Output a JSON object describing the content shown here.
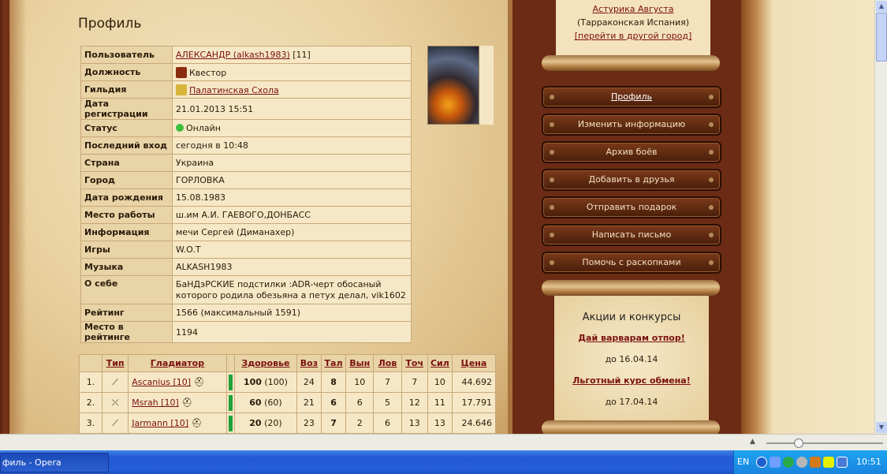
{
  "page": {
    "title": "Профиль"
  },
  "profile": {
    "rows": [
      {
        "key": "Пользователь",
        "value": "АЛЕКСАНДР (alkash1983)",
        "extra": " [11]"
      },
      {
        "key": "Должность",
        "value": "Квестор"
      },
      {
        "key": "Гильдия",
        "value": "Палатинская Схола"
      },
      {
        "key": "Дата регистрации",
        "value": "21.01.2013 15:51"
      },
      {
        "key": "Статус",
        "value": "Онлайн"
      },
      {
        "key": "Последний вход",
        "value": "сегодня в 10:48"
      },
      {
        "key": "Страна",
        "value": "Украина"
      },
      {
        "key": "Город",
        "value": "ГОРЛОВКА"
      },
      {
        "key": "Дата рождения",
        "value": "15.08.1983"
      },
      {
        "key": "Место работы",
        "value": "ш.им А.И. ГАЕВОГО,ДОНБАСС"
      },
      {
        "key": "Информация",
        "value": "мечи Сергей (Диманахер)"
      },
      {
        "key": "Игры",
        "value": "W.O.T"
      },
      {
        "key": "Музыка",
        "value": "ALKASH1983"
      },
      {
        "key": "О себе",
        "value": "БаНДэРСКИЕ подстилки :ADR-черт обосаный которого родила обезьяна а петух делал, vik1602"
      },
      {
        "key": "Рейтинг",
        "value": "1566 (максимальный 1591)"
      },
      {
        "key": "Место в рейтинге",
        "value": "1194"
      }
    ]
  },
  "gladiators": {
    "headers": [
      "Тип",
      "Гладиатор",
      "Здоровье",
      "Воз",
      "Тал",
      "Вын",
      "Лов",
      "Точ",
      "Сил",
      "Цена"
    ],
    "rows": [
      {
        "num": "1.",
        "name": "Ascanius [10]",
        "health": "100",
        "health_max": "(100)",
        "voz": "24",
        "tal": "8",
        "vyn": "10",
        "lov": "7",
        "toch": "7",
        "sil": "10",
        "price": "44.692"
      },
      {
        "num": "2.",
        "name": "Msrah [10]",
        "health": "60",
        "health_max": "(60)",
        "voz": "21",
        "tal": "6",
        "vyn": "6",
        "lov": "5",
        "toch": "12",
        "sil": "11",
        "price": "17.791"
      },
      {
        "num": "3.",
        "name": "Jarmann [10]",
        "health": "20",
        "health_max": "(20)",
        "voz": "23",
        "tal": "7",
        "vyn": "2",
        "lov": "6",
        "toch": "13",
        "sil": "13",
        "price": "24.646"
      }
    ]
  },
  "city": {
    "name": "Астурика Августа",
    "region": "(Тарраконская Испания)",
    "change_link": "[перейти в другой город]"
  },
  "menu": [
    "Профиль",
    "Изменить информацию",
    "Архив боёв",
    "Добавить в друзья",
    "Отправить подарок",
    "Написать письмо",
    "Помочь с раскопками"
  ],
  "promo": {
    "title": "Акции и конкурсы",
    "items": [
      {
        "label": "Дай варварам отпор!",
        "until": "до 16.04.14"
      },
      {
        "label": "Льготный курс обмена!",
        "until": "до 17.04.14"
      }
    ]
  },
  "taskbar": {
    "window": "филь - Opera",
    "lang": "EN",
    "time": "10:51"
  }
}
